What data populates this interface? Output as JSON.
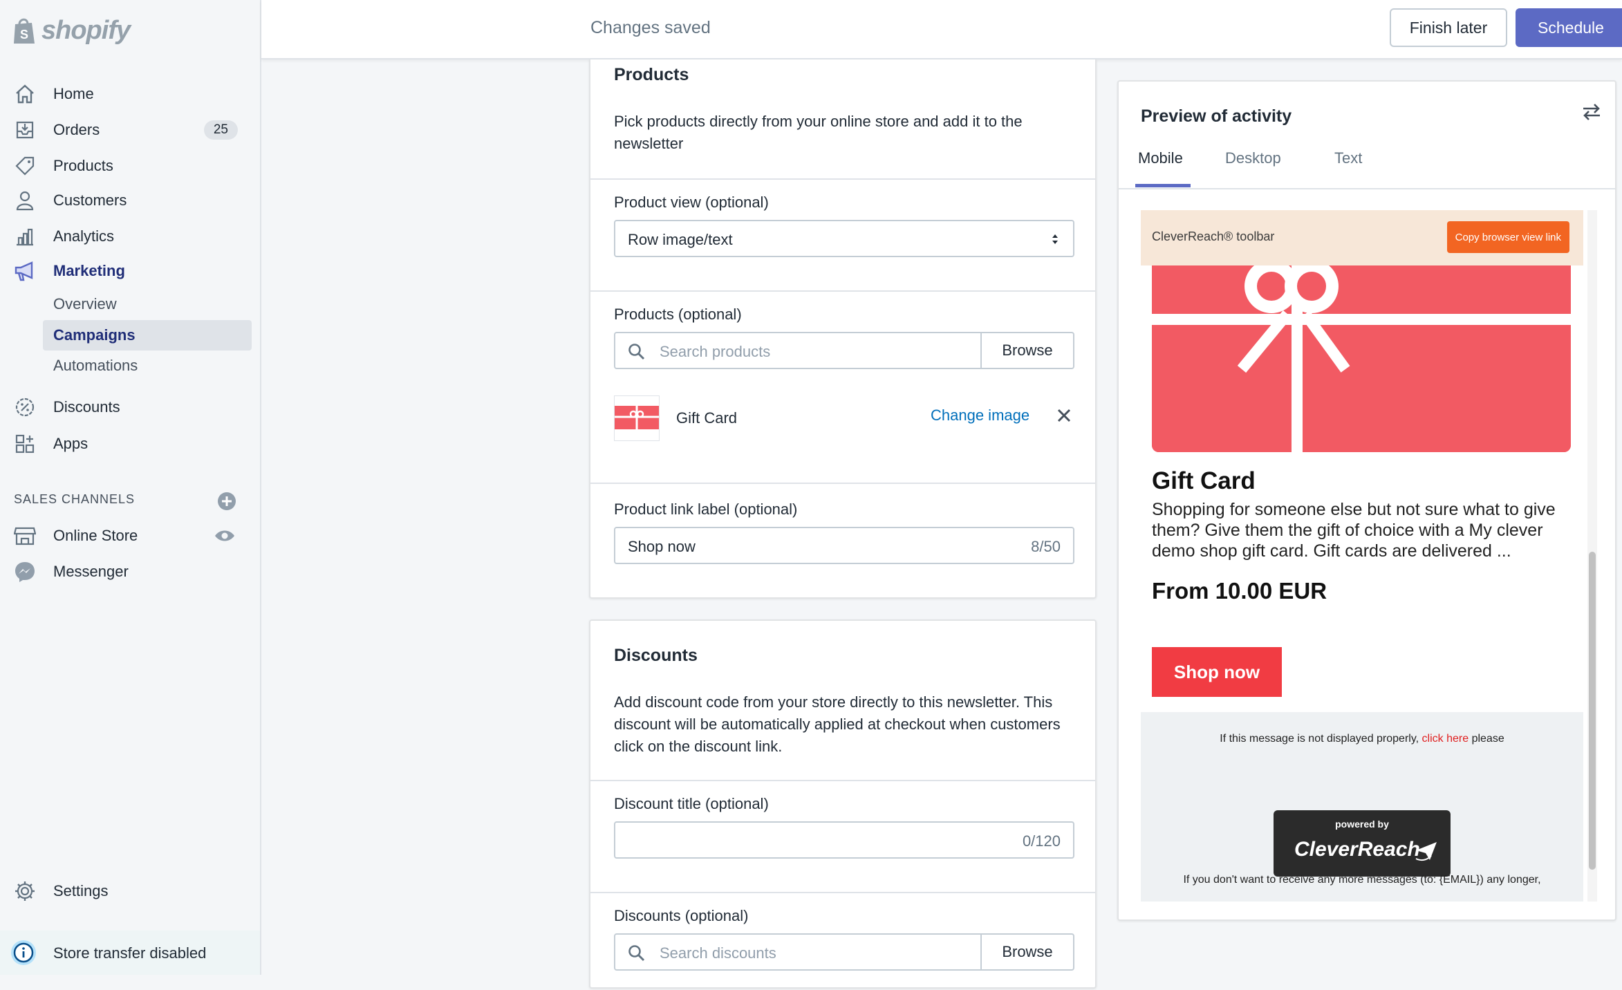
{
  "brand": {
    "name": "shopify"
  },
  "sidebar": {
    "items": [
      {
        "label": "Home",
        "icon": "home-icon"
      },
      {
        "label": "Orders",
        "icon": "orders-icon",
        "badge": "25"
      },
      {
        "label": "Products",
        "icon": "tag-icon"
      },
      {
        "label": "Customers",
        "icon": "person-icon"
      },
      {
        "label": "Analytics",
        "icon": "bar-chart-icon"
      },
      {
        "label": "Marketing",
        "icon": "megaphone-icon"
      }
    ],
    "marketing_sub": [
      {
        "label": "Overview"
      },
      {
        "label": "Campaigns",
        "active": true
      },
      {
        "label": "Automations"
      }
    ],
    "more_items": [
      {
        "label": "Discounts",
        "icon": "discount-icon"
      },
      {
        "label": "Apps",
        "icon": "apps-icon"
      }
    ],
    "sales_channels_label": "SALES CHANNELS",
    "channels": [
      {
        "label": "Online Store",
        "icon": "store-icon"
      },
      {
        "label": "Messenger",
        "icon": "messenger-icon"
      }
    ],
    "settings_label": "Settings",
    "store_transfer": "Store transfer disabled"
  },
  "topbar": {
    "status": "Changes saved",
    "finish_later": "Finish later",
    "schedule": "Schedule"
  },
  "products_card": {
    "title": "Products",
    "description": "Pick products directly from your online store and add it to the newsletter",
    "product_view_label": "Product view (optional)",
    "product_view_value": "Row image/text",
    "products_label": "Products (optional)",
    "search_placeholder": "Search products",
    "browse": "Browse",
    "product_name": "Gift Card",
    "change_image": "Change image",
    "link_label": "Product link label (optional)",
    "link_value": "Shop now",
    "link_counter": "8/50"
  },
  "discounts_card": {
    "title": "Discounts",
    "description": "Add discount code from your store directly to this newsletter. This discount will be automatically applied at checkout when customers click on the discount link.",
    "discount_title_label": "Discount title (optional)",
    "discount_title_counter": "0/120",
    "discounts_label": "Discounts (optional)",
    "search_placeholder": "Search discounts",
    "browse": "Browse"
  },
  "preview": {
    "title": "Preview of activity",
    "tabs": [
      "Mobile",
      "Desktop",
      "Text"
    ],
    "toolbar_label": "CleverReach® toolbar",
    "toolbar_button": "Copy browser view link",
    "product_title": "Gift Card",
    "product_desc": "Shopping for someone else but not sure what to give them? Give them the gift of choice with a My clever demo shop gift card. Gift cards are delivered ...",
    "price": "From 10.00 EUR",
    "shop_button": "Shop now",
    "footer_pre": "If this message is not displayed properly,",
    "footer_link": "click here",
    "footer_post": "please",
    "powered_small": "powered by",
    "powered_big": "CleverReach",
    "footer_unsub": "If you don't want to receive any more messages (to: {EMAIL}) any longer,"
  },
  "colors": {
    "accent": "#5c6ac4",
    "active_nav": "#202e78",
    "link": "#006fbb",
    "gift_red": "#f25a63",
    "shop_red": "#f13c43",
    "toolbar_orange": "#f26522"
  }
}
